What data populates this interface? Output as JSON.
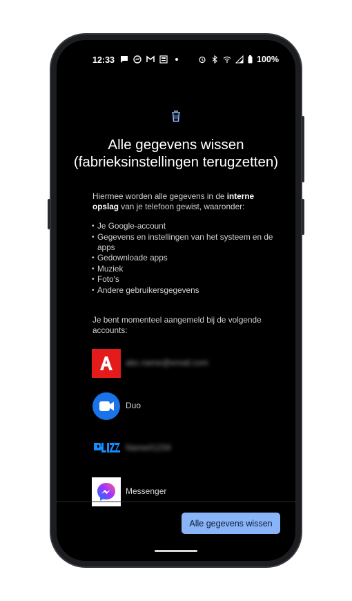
{
  "status_bar": {
    "time": "12:33",
    "battery": "100%",
    "left_icons": [
      "message-icon",
      "messenger-icon",
      "gmail-icon",
      "news-icon",
      "dot-icon"
    ],
    "right_icons": [
      "alarm-icon",
      "bluetooth-icon",
      "wifi-icon",
      "signal-icon",
      "battery-icon"
    ]
  },
  "header": {
    "icon": "trash-icon",
    "icon_color": "#8ab4f8",
    "title": "Alle gegevens wissen (fabrieksinstellingen terugzetten)"
  },
  "intro": {
    "part1": "Hiermee worden alle gegevens in de ",
    "bold": "interne opslag",
    "part2": " van je telefoon gewist, waaronder:"
  },
  "items": [
    "Je Google-account",
    "Gegevens en instellingen van het systeem en de apps",
    "Gedownloade apps",
    "Muziek",
    "Foto's",
    "Andere gebruikersgegevens"
  ],
  "accounts_intro": "Je bent momenteel aangemeld bij de volgende accounts:",
  "accounts": [
    {
      "icon": "adobe-icon",
      "label": "abc.name@email.com",
      "blurred": true,
      "color": "#e31b1b"
    },
    {
      "icon": "duo-icon",
      "label": "Duo",
      "blurred": false,
      "color": "#1a73e8"
    },
    {
      "icon": "blizzard-icon",
      "label": "Name#1234",
      "blurred": true,
      "color": "#148eff"
    },
    {
      "icon": "messenger-icon",
      "label": "Messenger",
      "blurred": false,
      "color": "#a033ff"
    }
  ],
  "primary_button": {
    "label": "Alle gegevens wissen",
    "color": "#8ab4f8"
  }
}
